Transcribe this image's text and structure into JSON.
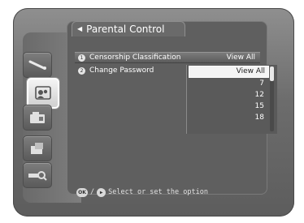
{
  "title": "Parental Control",
  "menu": [
    {
      "num": "1",
      "label": "Censorship Classification",
      "value": "View All"
    },
    {
      "num": "2",
      "label": "Change Password",
      "value": ""
    }
  ],
  "dropdown": {
    "selected_option": "View All",
    "options": [
      "7",
      "12",
      "15",
      "18"
    ]
  },
  "hint": {
    "ok_key": "OK",
    "separator": "/",
    "text": "Select or set the option"
  },
  "sidebar_icons": [
    "satellite-icon",
    "parental-lock-icon",
    "system-tools-icon",
    "antenna-setup-icon",
    "signal-search-icon"
  ],
  "colors": {
    "background": "#6c6c6c",
    "highlight": "#f4f4f4",
    "text": "#ffffff"
  }
}
